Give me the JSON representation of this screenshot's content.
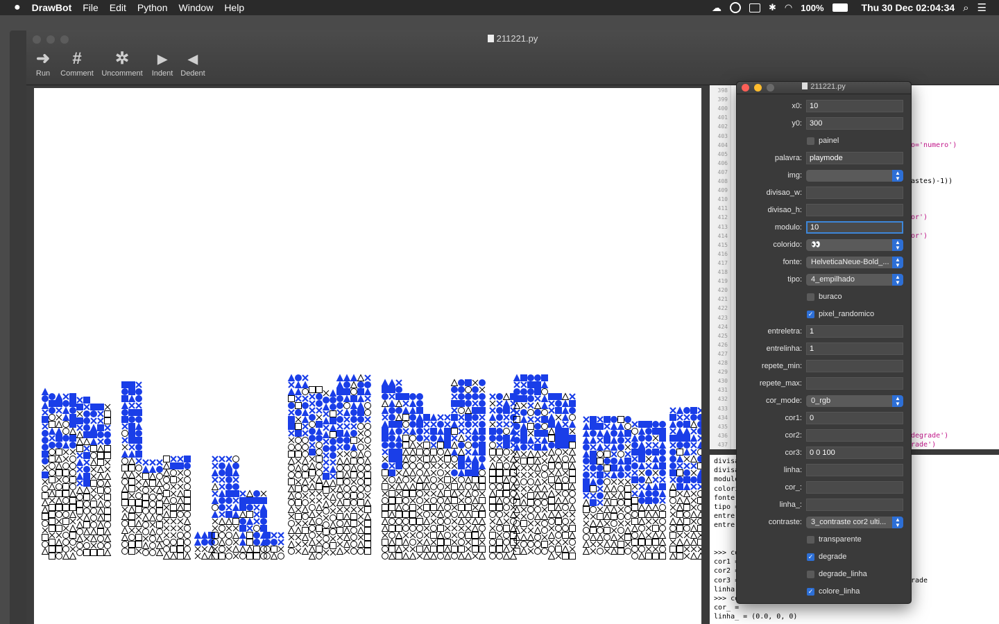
{
  "menubar": {
    "app": "DrawBot",
    "items": [
      "File",
      "Edit",
      "Python",
      "Window",
      "Help"
    ],
    "battery": "100%",
    "clock": "Thu 30 Dec  02:04:34",
    "icons": [
      "apple-icon",
      "creative-cloud-icon",
      "circle-icon",
      "keyboard-icon",
      "bluetooth-icon",
      "wifi-icon",
      "battery-icon",
      "search-icon",
      "list-icon"
    ]
  },
  "window": {
    "title": "211221.py",
    "toolbar": [
      {
        "label": "Run",
        "icon": "➜"
      },
      {
        "label": "Comment",
        "icon": "#"
      },
      {
        "label": "Uncomment",
        "icon": "✲"
      },
      {
        "label": "Indent",
        "icon": "▶"
      },
      {
        "label": "Dedent",
        "icon": "◀"
      }
    ]
  },
  "canvas": {
    "word": "PLAYMODE",
    "fill_color": "#1a3ee8",
    "outline_color": "#000000"
  },
  "editor": {
    "line_numbers": [
      "398",
      "399",
      "400",
      "401",
      "402",
      "403",
      "404",
      "405",
      "406",
      "407",
      "408",
      "409",
      "410",
      "411",
      "412",
      "413",
      "414",
      "415",
      "416",
      "417",
      "418",
      "419",
      "420",
      "421",
      "422",
      "423",
      "424",
      "425",
      "426",
      "427",
      "428",
      "429",
      "430",
      "431",
      "432",
      "433",
      "434",
      "435",
      "436",
      "437"
    ],
    "visible_fragments": [
      {
        "text": "o='numero')",
        "line": "404"
      },
      {
        "text": "astes)-1))",
        "line": "408"
      },
      {
        "text": "or')",
        "line": "412"
      },
      {
        "text": "or')",
        "line": "414"
      },
      {
        "text": "degrade')",
        "line": "436"
      },
      {
        "text": "rade')",
        "line": "437"
      }
    ]
  },
  "console": {
    "lines": [
      "divisa",
      "divisa",
      "modulo",
      "colori",
      "fonte",
      "tipo =",
      "entre",
      "entre",
      "",
      "",
      ">>> co",
      "cor1 =",
      "cor2 =",
      "cor3 =",
      "linha",
      ">>> co",
      "cor_ =",
      "linha_ = (0.0, 0, 0)"
    ],
    "right_fragment": "rade"
  },
  "panel": {
    "title": "211221.py",
    "rows": [
      {
        "type": "text",
        "label": "x0:",
        "value": "10"
      },
      {
        "type": "text",
        "label": "y0:",
        "value": "300"
      },
      {
        "type": "check",
        "label": "painel",
        "checked": false
      },
      {
        "type": "text",
        "label": "palavra:",
        "value": "playmode"
      },
      {
        "type": "select",
        "label": "img:",
        "value": ""
      },
      {
        "type": "text",
        "label": "divisao_w:",
        "value": ""
      },
      {
        "type": "text",
        "label": "divisao_h:",
        "value": ""
      },
      {
        "type": "text",
        "label": "modulo:",
        "value": "10",
        "focus": true
      },
      {
        "type": "select",
        "label": "colorido:",
        "value": "👀"
      },
      {
        "type": "select",
        "label": "fonte:",
        "value": "HelveticaNeue-Bold_..."
      },
      {
        "type": "select",
        "label": "tipo:",
        "value": "4_empilhado"
      },
      {
        "type": "check",
        "label": "buraco",
        "checked": false
      },
      {
        "type": "check",
        "label": "pixel_randomico",
        "checked": true
      },
      {
        "type": "text",
        "label": "entreletra:",
        "value": "1"
      },
      {
        "type": "text",
        "label": "entrelinha:",
        "value": "1"
      },
      {
        "type": "text",
        "label": "repete_min:",
        "value": ""
      },
      {
        "type": "text",
        "label": "repete_max:",
        "value": ""
      },
      {
        "type": "select",
        "label": "cor_mode:",
        "value": "0_rgb"
      },
      {
        "type": "text",
        "label": "cor1:",
        "value": "0"
      },
      {
        "type": "text",
        "label": "cor2:",
        "value": ""
      },
      {
        "type": "text",
        "label": "cor3:",
        "value": "0 0 100"
      },
      {
        "type": "text",
        "label": "linha:",
        "value": ""
      },
      {
        "type": "text",
        "label": "cor_:",
        "value": ""
      },
      {
        "type": "text",
        "label": "linha_:",
        "value": ""
      },
      {
        "type": "select",
        "label": "contraste:",
        "value": "3_contraste cor2 ulti..."
      },
      {
        "type": "check",
        "label": "transparente",
        "checked": false
      },
      {
        "type": "check",
        "label": "degrade",
        "checked": true
      },
      {
        "type": "check",
        "label": "degrade_linha",
        "checked": false
      },
      {
        "type": "check",
        "label": "colore_linha",
        "checked": true
      }
    ]
  }
}
